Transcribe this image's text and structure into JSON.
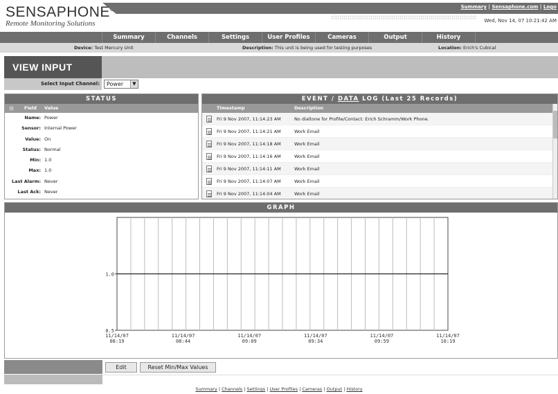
{
  "brand": {
    "name": "SENSAPHONE",
    "reg": "®",
    "subtitle": "Remote Monitoring Solutions"
  },
  "toplinks": [
    "Summary",
    "Sensaphone.com",
    "Logo"
  ],
  "datetime": "Wed, Nov 14, 07 10:21:42 AM",
  "nav": [
    "Summary",
    "Channels",
    "Settings",
    "User Profiles",
    "Cameras",
    "Output",
    "History"
  ],
  "info": {
    "device_label": "Device:",
    "device": "Test Mercury Unit",
    "desc_label": "Description:",
    "desc": "This unit is being used for testing purposes",
    "loc_label": "Location:",
    "loc": "Erich's Cubical"
  },
  "page_title": "VIEW INPUT",
  "select": {
    "label": "Select Input Channel:",
    "value": "Power"
  },
  "status": {
    "title": "STATUS",
    "col_field": "Field",
    "col_value": "Value",
    "rows": [
      {
        "k": "Name:",
        "v": "Power"
      },
      {
        "k": "Sensor:",
        "v": "Internal Power"
      },
      {
        "k": "Value:",
        "v": "On"
      },
      {
        "k": "Status:",
        "v": "Normal"
      },
      {
        "k": "Min:",
        "v": "1.0"
      },
      {
        "k": "Max:",
        "v": "1.0"
      },
      {
        "k": "Last Alarm:",
        "v": "Never"
      },
      {
        "k": "Last Ack:",
        "v": "Never"
      }
    ]
  },
  "event": {
    "title_pre": "EVENT / ",
    "title_link": "DATA",
    "title_post": " LOG (Last 25 Records)",
    "col_ts": "Timestamp",
    "col_desc": "Description",
    "rows": [
      {
        "ts": "Fri 9 Nov 2007, 11:14:23 AM",
        "d": "No dialtone for Profile/Contact: Erich Schramm/Work Phone."
      },
      {
        "ts": "Fri 9 Nov 2007, 11:14:21 AM",
        "d": "Work Email"
      },
      {
        "ts": "Fri 9 Nov 2007, 11:14:18 AM",
        "d": "Work Email"
      },
      {
        "ts": "Fri 9 Nov 2007, 11:14:16 AM",
        "d": "Work Email"
      },
      {
        "ts": "Fri 9 Nov 2007, 11:14:11 AM",
        "d": "Work Email"
      },
      {
        "ts": "Fri 9 Nov 2007, 11:14:07 AM",
        "d": "Work Email"
      },
      {
        "ts": "Fri 9 Nov 2007, 11:14:04 AM",
        "d": "Work Email"
      }
    ]
  },
  "graph": {
    "title": "GRAPH"
  },
  "chart_data": {
    "type": "line",
    "x": [
      "11/14/07 08:19",
      "11/14/07 08:44",
      "11/14/07 09:09",
      "11/14/07 09:34",
      "11/14/07 09:59",
      "11/14/07 10:19"
    ],
    "y_ticks": [
      "1.0",
      "0.5"
    ],
    "series": [
      {
        "values": [
          1.0,
          1.0,
          1.0,
          1.0,
          1.0,
          1.0
        ]
      }
    ],
    "ylim": [
      0.5,
      1.5
    ],
    "grid": true
  },
  "buttons": {
    "edit": "Edit",
    "reset": "Reset Min/Max Values"
  },
  "footer": [
    "Summary",
    "Channels",
    "Settings",
    "User Profiles",
    "Cameras",
    "Output",
    "History"
  ]
}
